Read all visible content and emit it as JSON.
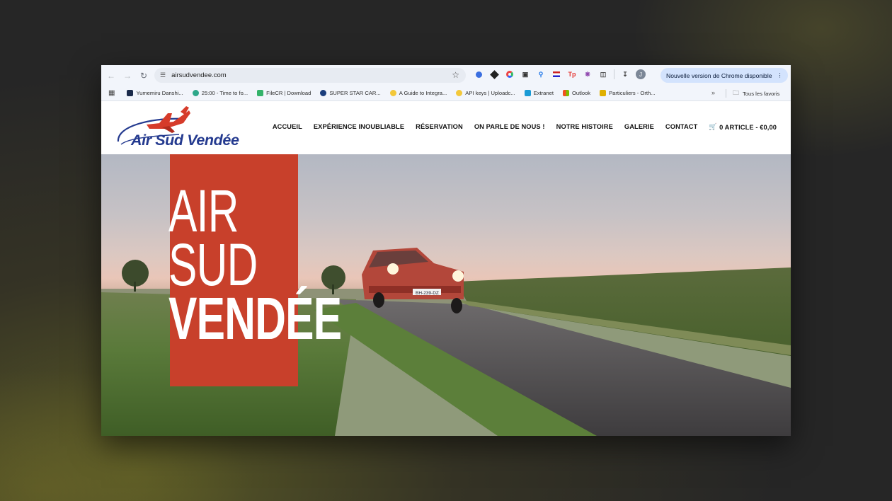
{
  "browser": {
    "url": "airsudvendee.com",
    "update_label": "Nouvelle version de Chrome disponible",
    "profile_initial": "J",
    "bookmarks": [
      {
        "label": "Yumemiru Danshi...",
        "color": "#1b2a4a"
      },
      {
        "label": "25:00 - Time to fo...",
        "color": "#2ea88a"
      },
      {
        "label": "FileCR | Download",
        "color": "#34b36a"
      },
      {
        "label": "SUPER STAR CAR...",
        "color": "#1a3d7c"
      },
      {
        "label": "A Guide to Integra...",
        "color": "#f3c83a"
      },
      {
        "label": "API keys | Uploadc...",
        "color": "#f3c83a"
      },
      {
        "label": "Extranet",
        "color": "#1a9bd6"
      },
      {
        "label": "Outlook",
        "color": "#0f6cbd"
      },
      {
        "label": "Particuliers - Orth...",
        "color": "#e0b000"
      }
    ],
    "all_bookmarks_label": "Tous les favoris"
  },
  "site": {
    "logo_text": "Air Sud Vendée",
    "menu": [
      "ACCUEIL",
      "EXPÉRIENCE INOUBLIABLE",
      "RÉSERVATION",
      "ON PARLE DE NOUS !",
      "NOTRE HISTOIRE",
      "GALERIE",
      "CONTACT"
    ],
    "cart_label": "0 ARTICLE - €0,00"
  },
  "hero": {
    "line1": "AIR",
    "line2": "SUD",
    "line3": "VENDÉE",
    "plate": "BH-239-DZ"
  },
  "colors": {
    "brand_red": "#c8402b",
    "brand_blue": "#243a8f",
    "update_pill": "#d3e3fd"
  }
}
